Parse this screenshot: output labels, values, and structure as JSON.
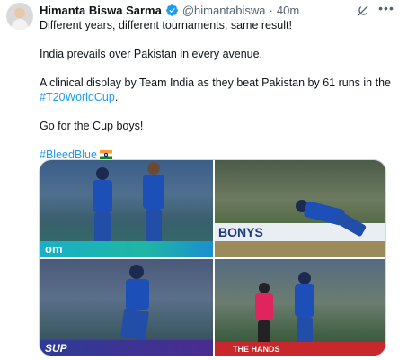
{
  "tweet": {
    "author_name": "Himanta Biswa Sarma",
    "handle": "@himantabiswa",
    "separator": "·",
    "time": "40m",
    "lines": [
      "Different years, different tournaments, same result!",
      "India prevails over Pakistan in every avenue.",
      "A clinical display by Team India as they beat Pakistan by 61 runs in the",
      "#T20WorldCup",
      "Go for the Cup boys!",
      "#BleedBlue"
    ],
    "period_after_hashtag": "."
  },
  "media": {
    "photos": [
      {
        "banner_text": "om"
      },
      {
        "banner_text": "BONYS"
      },
      {
        "banner_text": "SUP"
      },
      {
        "banner_text": "THE HANDS"
      }
    ]
  },
  "icons": {
    "verified": "verified-badge-icon",
    "grok": "grok-icon",
    "more": "more-options-icon",
    "flag": "india-flag-emoji"
  },
  "colors": {
    "link": "#1d9bf0",
    "muted": "#536471",
    "verified": "#1d9bf0"
  }
}
